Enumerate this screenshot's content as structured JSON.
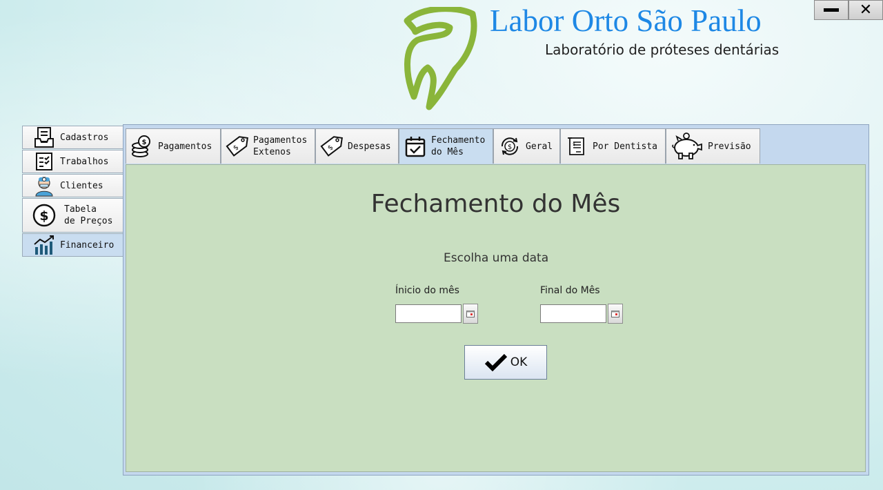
{
  "header": {
    "title": "Labor Orto São Paulo",
    "subtitle": "Laboratório de próteses dentárias"
  },
  "window_controls": {
    "minimize_icon": "minimize-icon",
    "close_icon": "close-icon"
  },
  "side_nav": {
    "items": [
      {
        "label": "Cadastros",
        "icon": "document-tray-icon"
      },
      {
        "label": "Trabalhos",
        "icon": "checklist-icon"
      },
      {
        "label": "Clientes",
        "icon": "dentist-icon"
      },
      {
        "label_line1": "Tabela",
        "label_line2": "de Preços",
        "icon": "dollar-coin-icon"
      },
      {
        "label": "Financeiro",
        "icon": "growth-chart-icon",
        "active": true
      }
    ]
  },
  "tabs": [
    {
      "label": "Pagamentos",
      "icon": "coins-stack-icon"
    },
    {
      "label_line1": "Pagamentos",
      "label_line2": "Extenos",
      "icon": "price-tag-icon"
    },
    {
      "label": "Despesas",
      "icon": "price-tag-icon"
    },
    {
      "label_line1": "Fechamento",
      "label_line2": "do Mês",
      "icon": "calendar-check-icon",
      "active": true
    },
    {
      "label": "Geral",
      "icon": "dollar-cycle-icon"
    },
    {
      "label": "Por Dentista",
      "icon": "receipt-icon"
    },
    {
      "label": "Previsão",
      "icon": "piggy-bank-icon"
    }
  ],
  "form": {
    "title": "Fechamento do Mês",
    "prompt": "Escolha uma data",
    "start_label": "Ínicio do mês",
    "start_value": "",
    "end_label": "Final do Mês",
    "end_value": "",
    "ok_label": "OK"
  },
  "colors": {
    "brand": "#1e88e5",
    "logo_green": "#8ab53a",
    "content_bg": "#c9dfc1",
    "active_tab": "#c9ddf0"
  }
}
